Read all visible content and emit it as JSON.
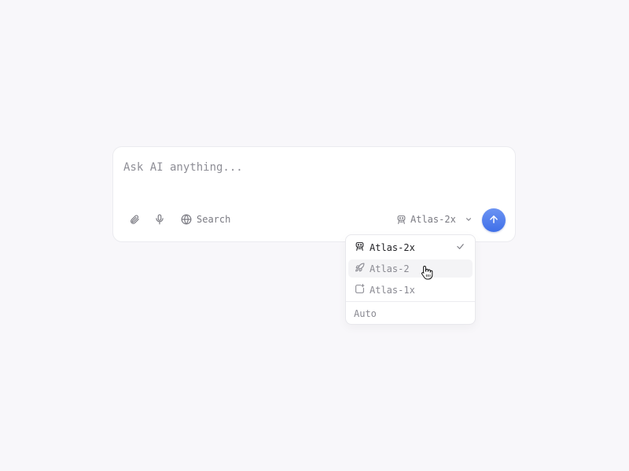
{
  "composer": {
    "placeholder": "Ask AI anything...",
    "search_label": "Search",
    "selected_model": "Atlas-2x"
  },
  "dropdown": {
    "items": [
      {
        "label": "Atlas-2x",
        "icon": "robot-icon",
        "selected": true
      },
      {
        "label": "Atlas-2",
        "icon": "rocket-icon",
        "selected": false
      },
      {
        "label": "Atlas-1x",
        "icon": "sparkle-square-icon",
        "selected": false
      }
    ],
    "auto_label": "Auto"
  },
  "colors": {
    "background": "#f8f7fa",
    "send_button": "#4a78ec",
    "text_muted": "#8a8a92",
    "text_selected": "#222226"
  }
}
